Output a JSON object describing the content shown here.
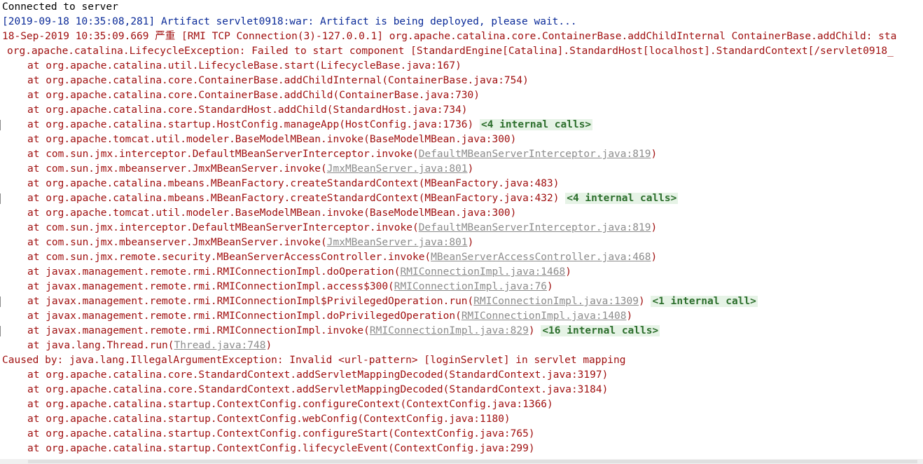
{
  "console": {
    "lines": [
      {
        "indent": "top",
        "parts": [
          {
            "t": "Connected to server",
            "c": "norm"
          }
        ]
      },
      {
        "indent": "top",
        "parts": [
          {
            "t": "[2019-09-18 10:35:08,281] Artifact servlet0918:war: Artifact is being deployed, please wait...",
            "c": "blue"
          }
        ]
      },
      {
        "indent": "top",
        "parts": [
          {
            "t": "18-Sep-2019 10:35:09.669 严重 [RMI TCP Connection(3)-127.0.0.1] org.apache.catalina.core.ContainerBase.addChildInternal ContainerBase.addChild: sta",
            "c": "red"
          }
        ]
      },
      {
        "indent": "ex",
        "parts": [
          {
            "t": "org.apache.catalina.LifecycleException: Failed to start component [StandardEngine[Catalina].StandardHost[localhost].StandardContext[/servlet0918_",
            "c": "red"
          }
        ]
      },
      {
        "indent": "frame",
        "parts": [
          {
            "t": "at org.apache.catalina.util.LifecycleBase.start(LifecycleBase.java:167)",
            "c": "red"
          }
        ]
      },
      {
        "indent": "frame",
        "parts": [
          {
            "t": "at org.apache.catalina.core.ContainerBase.addChildInternal(ContainerBase.java:754)",
            "c": "red"
          }
        ]
      },
      {
        "indent": "frame",
        "parts": [
          {
            "t": "at org.apache.catalina.core.ContainerBase.addChild(ContainerBase.java:730)",
            "c": "red"
          }
        ]
      },
      {
        "indent": "frame",
        "parts": [
          {
            "t": "at org.apache.catalina.core.StandardHost.addChild(StandardHost.java:734)",
            "c": "red"
          }
        ]
      },
      {
        "indent": "frame",
        "fold": true,
        "parts": [
          {
            "t": "at org.apache.catalina.startup.HostConfig.manageApp(HostConfig.java:1736)",
            "c": "red"
          },
          {
            "t": " ",
            "c": "red"
          },
          {
            "t": "<4 internal calls>",
            "c": "calls"
          }
        ]
      },
      {
        "indent": "frame",
        "parts": [
          {
            "t": "at org.apache.tomcat.util.modeler.BaseModelMBean.invoke(BaseModelMBean.java:300)",
            "c": "red"
          }
        ]
      },
      {
        "indent": "frame",
        "parts": [
          {
            "t": "at com.sun.jmx.interceptor.DefaultMBeanServerInterceptor.invoke(",
            "c": "red"
          },
          {
            "t": "DefaultMBeanServerInterceptor.java:819",
            "c": "link"
          },
          {
            "t": ")",
            "c": "red"
          }
        ]
      },
      {
        "indent": "frame",
        "parts": [
          {
            "t": "at com.sun.jmx.mbeanserver.JmxMBeanServer.invoke(",
            "c": "red"
          },
          {
            "t": "JmxMBeanServer.java:801",
            "c": "link"
          },
          {
            "t": ")",
            "c": "red"
          }
        ]
      },
      {
        "indent": "frame",
        "parts": [
          {
            "t": "at org.apache.catalina.mbeans.MBeanFactory.createStandardContext(MBeanFactory.java:483)",
            "c": "red"
          }
        ]
      },
      {
        "indent": "frame",
        "fold": true,
        "parts": [
          {
            "t": "at org.apache.catalina.mbeans.MBeanFactory.createStandardContext(MBeanFactory.java:432)",
            "c": "red"
          },
          {
            "t": " ",
            "c": "red"
          },
          {
            "t": "<4 internal calls>",
            "c": "calls"
          }
        ]
      },
      {
        "indent": "frame",
        "parts": [
          {
            "t": "at org.apache.tomcat.util.modeler.BaseModelMBean.invoke(BaseModelMBean.java:300)",
            "c": "red"
          }
        ]
      },
      {
        "indent": "frame",
        "parts": [
          {
            "t": "at com.sun.jmx.interceptor.DefaultMBeanServerInterceptor.invoke(",
            "c": "red"
          },
          {
            "t": "DefaultMBeanServerInterceptor.java:819",
            "c": "link"
          },
          {
            "t": ")",
            "c": "red"
          }
        ]
      },
      {
        "indent": "frame",
        "parts": [
          {
            "t": "at com.sun.jmx.mbeanserver.JmxMBeanServer.invoke(",
            "c": "red"
          },
          {
            "t": "JmxMBeanServer.java:801",
            "c": "link"
          },
          {
            "t": ")",
            "c": "red"
          }
        ]
      },
      {
        "indent": "frame",
        "parts": [
          {
            "t": "at com.sun.jmx.remote.security.MBeanServerAccessController.invoke(",
            "c": "red"
          },
          {
            "t": "MBeanServerAccessController.java:468",
            "c": "link"
          },
          {
            "t": ")",
            "c": "red"
          }
        ]
      },
      {
        "indent": "frame",
        "parts": [
          {
            "t": "at javax.management.remote.rmi.RMIConnectionImpl.doOperation(",
            "c": "red"
          },
          {
            "t": "RMIConnectionImpl.java:1468",
            "c": "link"
          },
          {
            "t": ")",
            "c": "red"
          }
        ]
      },
      {
        "indent": "frame",
        "parts": [
          {
            "t": "at javax.management.remote.rmi.RMIConnectionImpl.access$300(",
            "c": "red"
          },
          {
            "t": "RMIConnectionImpl.java:76",
            "c": "link"
          },
          {
            "t": ")",
            "c": "red"
          }
        ]
      },
      {
        "indent": "frame",
        "fold": true,
        "parts": [
          {
            "t": "at javax.management.remote.rmi.RMIConnectionImpl$PrivilegedOperation.run(",
            "c": "red"
          },
          {
            "t": "RMIConnectionImpl.java:1309",
            "c": "link"
          },
          {
            "t": ") ",
            "c": "red"
          },
          {
            "t": "<1 internal call>",
            "c": "calls"
          }
        ]
      },
      {
        "indent": "frame",
        "parts": [
          {
            "t": "at javax.management.remote.rmi.RMIConnectionImpl.doPrivilegedOperation(",
            "c": "red"
          },
          {
            "t": "RMIConnectionImpl.java:1408",
            "c": "link"
          },
          {
            "t": ")",
            "c": "red"
          }
        ]
      },
      {
        "indent": "frame",
        "fold": true,
        "parts": [
          {
            "t": "at javax.management.remote.rmi.RMIConnectionImpl.invoke(",
            "c": "red"
          },
          {
            "t": "RMIConnectionImpl.java:829",
            "c": "link"
          },
          {
            "t": ") ",
            "c": "red"
          },
          {
            "t": "<16 internal calls>",
            "c": "calls"
          }
        ]
      },
      {
        "indent": "frame",
        "parts": [
          {
            "t": "at java.lang.Thread.run(",
            "c": "red"
          },
          {
            "t": "Thread.java:748",
            "c": "link"
          },
          {
            "t": ")",
            "c": "red"
          }
        ]
      },
      {
        "indent": "top",
        "parts": [
          {
            "t": "Caused by: java.lang.IllegalArgumentException: Invalid <url-pattern> [loginServlet] in servlet mapping",
            "c": "red"
          }
        ]
      },
      {
        "indent": "frame",
        "parts": [
          {
            "t": "at org.apache.catalina.core.StandardContext.addServletMappingDecoded(StandardContext.java:3197)",
            "c": "red"
          }
        ]
      },
      {
        "indent": "frame",
        "parts": [
          {
            "t": "at org.apache.catalina.core.StandardContext.addServletMappingDecoded(StandardContext.java:3184)",
            "c": "red"
          }
        ]
      },
      {
        "indent": "frame",
        "parts": [
          {
            "t": "at org.apache.catalina.startup.ContextConfig.configureContext(ContextConfig.java:1366)",
            "c": "red"
          }
        ]
      },
      {
        "indent": "frame",
        "parts": [
          {
            "t": "at org.apache.catalina.startup.ContextConfig.webConfig(ContextConfig.java:1180)",
            "c": "red"
          }
        ]
      },
      {
        "indent": "frame",
        "parts": [
          {
            "t": "at org.apache.catalina.startup.ContextConfig.configureStart(ContextConfig.java:765)",
            "c": "red"
          }
        ]
      },
      {
        "indent": "frame",
        "parts": [
          {
            "t": "at org.apache.catalina.startup.ContextConfig.lifecycleEvent(ContextConfig.java:299)",
            "c": "red"
          }
        ]
      }
    ]
  }
}
